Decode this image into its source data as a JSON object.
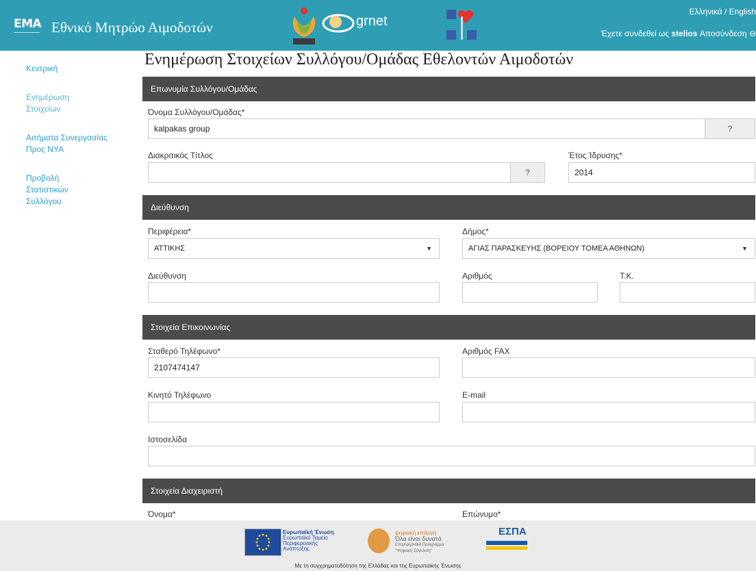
{
  "header": {
    "logo_text": "ΕΜΑ",
    "site_title": "Εθνικό Μητρώο Αιμοδοτών",
    "partner_grnet": "grnet",
    "lang_el": "Ελληνικά",
    "lang_sep": " / ",
    "lang_en": "English",
    "user_prefix": "Έχετε συνδεθεί ως ",
    "username": "stelios",
    "logout": " Αποσύνδεση ⊖",
    "brand_color": "#2f9eb4"
  },
  "sidebar": {
    "items": [
      {
        "label": "Κεντρική"
      },
      {
        "label": "Ενημέρωση Στοιχείων"
      },
      {
        "label": "Αιτήματα Συνεργασίας Προς ΝΥΑ"
      },
      {
        "label": "Προβολή Στατιστικών Συλλόγου"
      }
    ]
  },
  "main": {
    "title": "Ενημέρωση Στοιχείων Συλλόγου/Ομάδας Εθελοντών Αιμοδοτών",
    "sections": {
      "name": "Επωνυμία Συλλόγου/Ομάδας",
      "address": "Διεύθυνση",
      "contact": "Στοιχεία Επικοινωνίας",
      "manager": "Στοιχεία Διαχειριστή"
    },
    "fields": {
      "group_name_label": "Όνομα Συλλόγου/Ομάδας*",
      "group_name_value": "kalpakas group",
      "help": "?",
      "distinctive_title_label": "Διακριτικός Τίτλος",
      "distinctive_title_value": "",
      "founding_year_label": "Έτος Ίδρυσης*",
      "founding_year_value": "2014",
      "region_label": "Περιφέρεια*",
      "region_value": "ΑΤΤΙΚΗΣ",
      "municipality_label": "Δήμος*",
      "municipality_value": "ΑΓΙΑΣ ΠΑΡΑΣΚΕΥΗΣ (ΒΟΡΕΙΟΥ ΤΟΜΕΑ ΑΘΗΝΩΝ)",
      "address_label": "Διεύθυνση",
      "number_label": "Αριθμός",
      "postcode_label": "Τ.Κ.",
      "phone_label": "Σταθερό Τηλέφωνο*",
      "phone_value": "2107474147",
      "fax_label": "Αριθμός FAX",
      "mobile_label": "Κινητό Τηλέφωνο",
      "email_label": "E-mail",
      "website_label": "Ιστοσελίδα",
      "first_name_label": "Όνομα*",
      "last_name_label": "Επώνυμο*"
    },
    "section_color": "#4b4b4b"
  },
  "footer": {
    "eu_text": [
      "Ευρωπαϊκή Ένωση",
      "Ευρωπαϊκό Ταμείο",
      "Περιφερειακής",
      "Ανάπτυξης"
    ],
    "ps_text": [
      "ψηφιακή επιλογή",
      "Όλα είναι δυνατά",
      "Επιχειρησιακό Πρόγραμμα",
      "\"Ψηφιακή Σύγκλιση\""
    ],
    "espa": "ΕΣΠΑ",
    "caption": "Με τη συγχρηματοδότηση της Ελλάδας και της Ευρωπαϊκής Ένωσης"
  }
}
